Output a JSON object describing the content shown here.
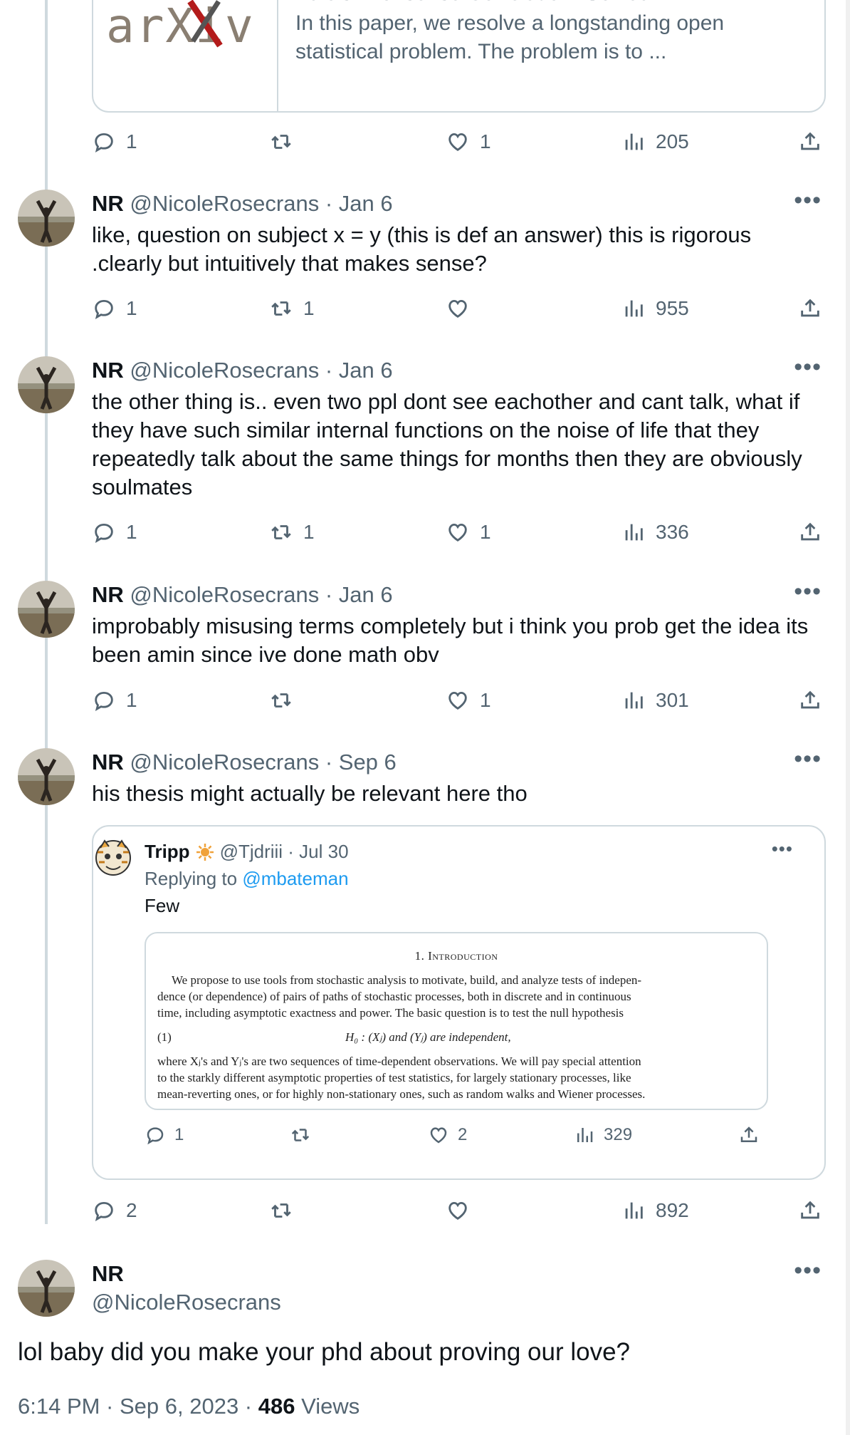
{
  "link_card": {
    "logo_text": "arXiv",
    "title": "Yule's \"Nonsense Correlation\" Solved!",
    "desc_line1": "In this paper, we resolve a longstanding open",
    "desc_line2": "statistical problem. The problem is to ..."
  },
  "actions_0": {
    "reply": "1",
    "retweet": "",
    "like": "1",
    "views": "205"
  },
  "tweets": [
    {
      "name": "NR",
      "handle": "@NicoleRosecrans",
      "date": "· Jan 6",
      "lines": [
        "like,  question on subject x = y (this is def an answer)   this is rigorous",
        ".clearly but intuitively that makes sense?"
      ],
      "reply": "1",
      "retweet": "1",
      "like": "",
      "views": "955"
    },
    {
      "name": "NR",
      "handle": "@NicoleRosecrans",
      "date": "· Jan 6",
      "lines": [
        "the other thing is.. even two ppl dont see eachother and cant talk, what if",
        "they have such similar internal functions on the noise of life that they",
        "repeatedly talk about the same things for months then they are obviously",
        "soulmates"
      ],
      "reply": "1",
      "retweet": "1",
      "like": "1",
      "views": "336"
    },
    {
      "name": "NR",
      "handle": "@NicoleRosecrans",
      "date": "· Jan 6",
      "lines": [
        "improbably misusing terms completely but i think you prob get the idea its",
        "been amin since ive done math obv"
      ],
      "reply": "1",
      "retweet": "",
      "like": "1",
      "views": "301"
    },
    {
      "name": "NR",
      "handle": "@NicoleRosecrans",
      "date": "· Sep 6",
      "lines": [
        "his thesis might actually be relevant here tho"
      ],
      "reply": "2",
      "retweet": "",
      "like": "",
      "views": "892"
    }
  ],
  "quote": {
    "name": "Tripp",
    "handle": "@Tjdriii · Jul 30",
    "replying_prefix": "Replying to ",
    "replying_handle": "@mbateman",
    "text": "Few",
    "paper_heading": "1. Introduction",
    "paper_lines": [
      "We propose to use tools from stochastic analysis to motivate, build, and analyze tests of indepen-",
      "dence (or dependence) of pairs of paths of stochastic processes, both in discrete and in continuous",
      "time, including asymptotic exactness and power. The basic question is to test the null hypothesis"
    ],
    "eq_number": "(1)",
    "eq_text": "H₀ : (Xⱼ) and (Yⱼ) are independent,",
    "paper_lines2": [
      "where Xⱼ's and Yⱼ's are two sequences of time-dependent observations. We will pay special attention",
      "to the starkly different asymptotic properties of test statistics, for largely stationary processes, like",
      "mean-reverting ones, or for highly non-stationary ones, such as random walks and Wiener processes."
    ],
    "reply": "1",
    "retweet": "",
    "like": "2",
    "views": "329"
  },
  "main": {
    "name": "NR",
    "handle": "@NicoleRosecrans",
    "text": "lol baby did you make your phd about proving our love?",
    "time": "6:14 PM · Sep 6, 2023 · ",
    "views_count": "486",
    "views_label": " Views"
  },
  "colors": {
    "link_blue": "#1d9bf0",
    "gray": "#536471",
    "border": "#cfd9de",
    "arxiv_red": "#b31b1b"
  },
  "icons": [
    "reply-icon",
    "retweet-icon",
    "like-icon",
    "views-icon",
    "share-icon",
    "more-icon",
    "sun-badge-icon"
  ]
}
